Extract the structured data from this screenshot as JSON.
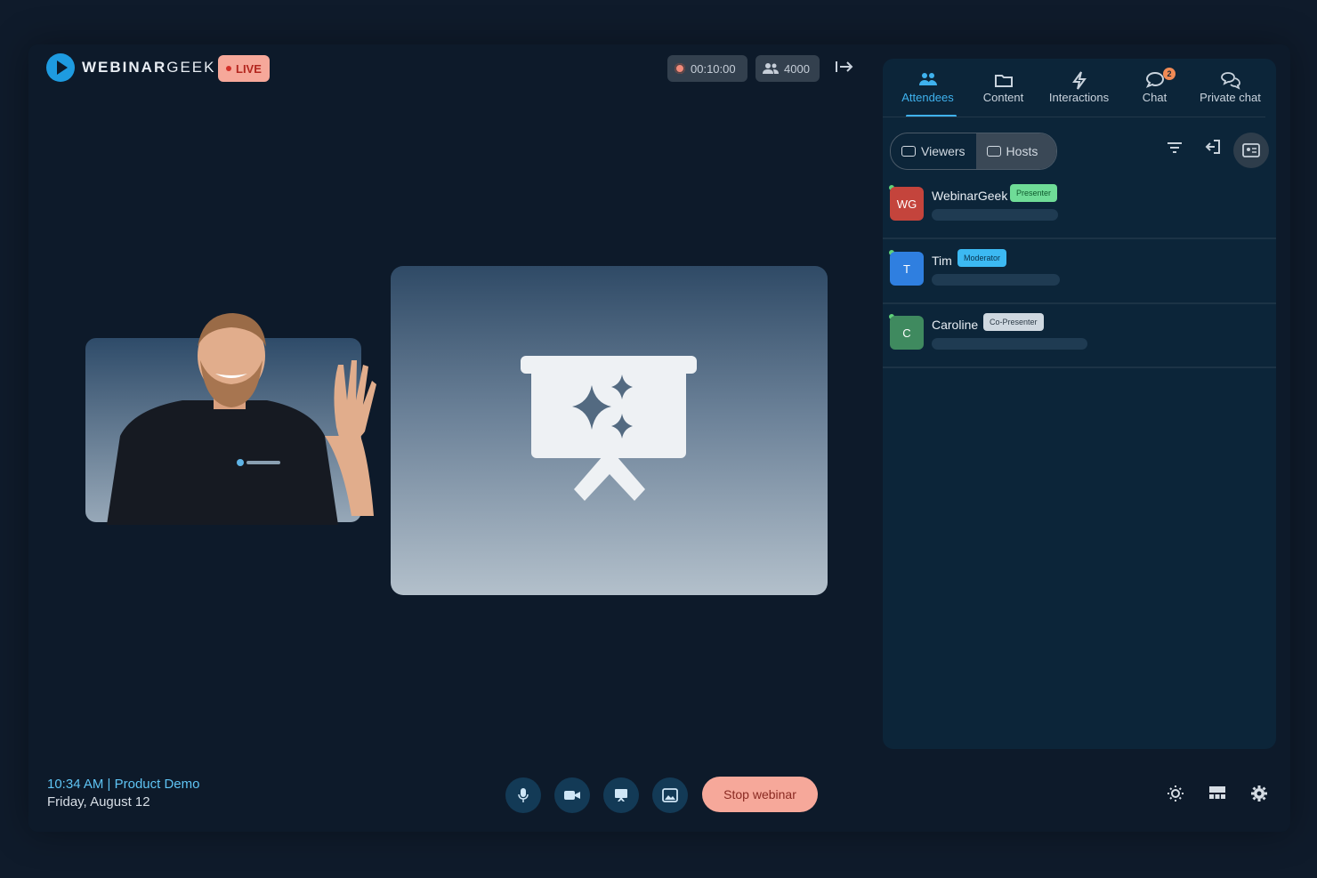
{
  "brand": {
    "name_bold": "WEBINAR",
    "name_thin": "GEEK",
    "live_label": "LIVE"
  },
  "header": {
    "timer": "00:10:00",
    "attendee_count": "4000",
    "icons": {
      "timer": "record-dot-icon",
      "attendees": "people-icon",
      "exit": "exit-arrow-icon"
    }
  },
  "panel": {
    "tabs": [
      {
        "label": "Attendees",
        "icon": "people-icon",
        "active": true
      },
      {
        "label": "Content",
        "icon": "folder-icon"
      },
      {
        "label": "Interactions",
        "icon": "lightning-icon"
      },
      {
        "label": "Chat",
        "icon": "chat-bubble-icon",
        "badge": "2"
      },
      {
        "label": "Private chat",
        "icon": "private-chat-icon"
      }
    ],
    "segment": {
      "viewers_label": "Viewers",
      "hosts_label": "Hosts",
      "selected": "Hosts"
    },
    "hosts": [
      {
        "initials": "WG",
        "name": "WebinarGeek",
        "role": "Presenter",
        "avatar_color": "#c4443c",
        "role_bg": "#6fdc97",
        "role_color": "#0f5a2e"
      },
      {
        "initials": "T",
        "name": "Tim",
        "role": "Moderator",
        "avatar_color": "#2f7fe0",
        "role_bg": "#3cb9f2",
        "role_color": "#08324d"
      },
      {
        "initials": "C",
        "name": "Caroline",
        "role": "Co-Presenter",
        "avatar_color": "#3f8a5f",
        "role_bg": "#cfd8e0",
        "role_color": "#2d3b47"
      }
    ]
  },
  "footer": {
    "time_title": "10:34 AM | Product Demo",
    "date": "Friday, August 12",
    "controls": [
      {
        "name": "microphone-icon"
      },
      {
        "name": "camera-icon"
      },
      {
        "name": "screen-share-icon"
      },
      {
        "name": "image-icon"
      }
    ],
    "stop_label": "Stop webinar",
    "right_icons": [
      "brightness-icon",
      "layout-icon",
      "settings-gear-icon"
    ]
  },
  "colors": {
    "accent": "#3fb2ee",
    "live": "#f6a89a",
    "stop": "#f6a89a",
    "background": "#0d1a2a"
  }
}
